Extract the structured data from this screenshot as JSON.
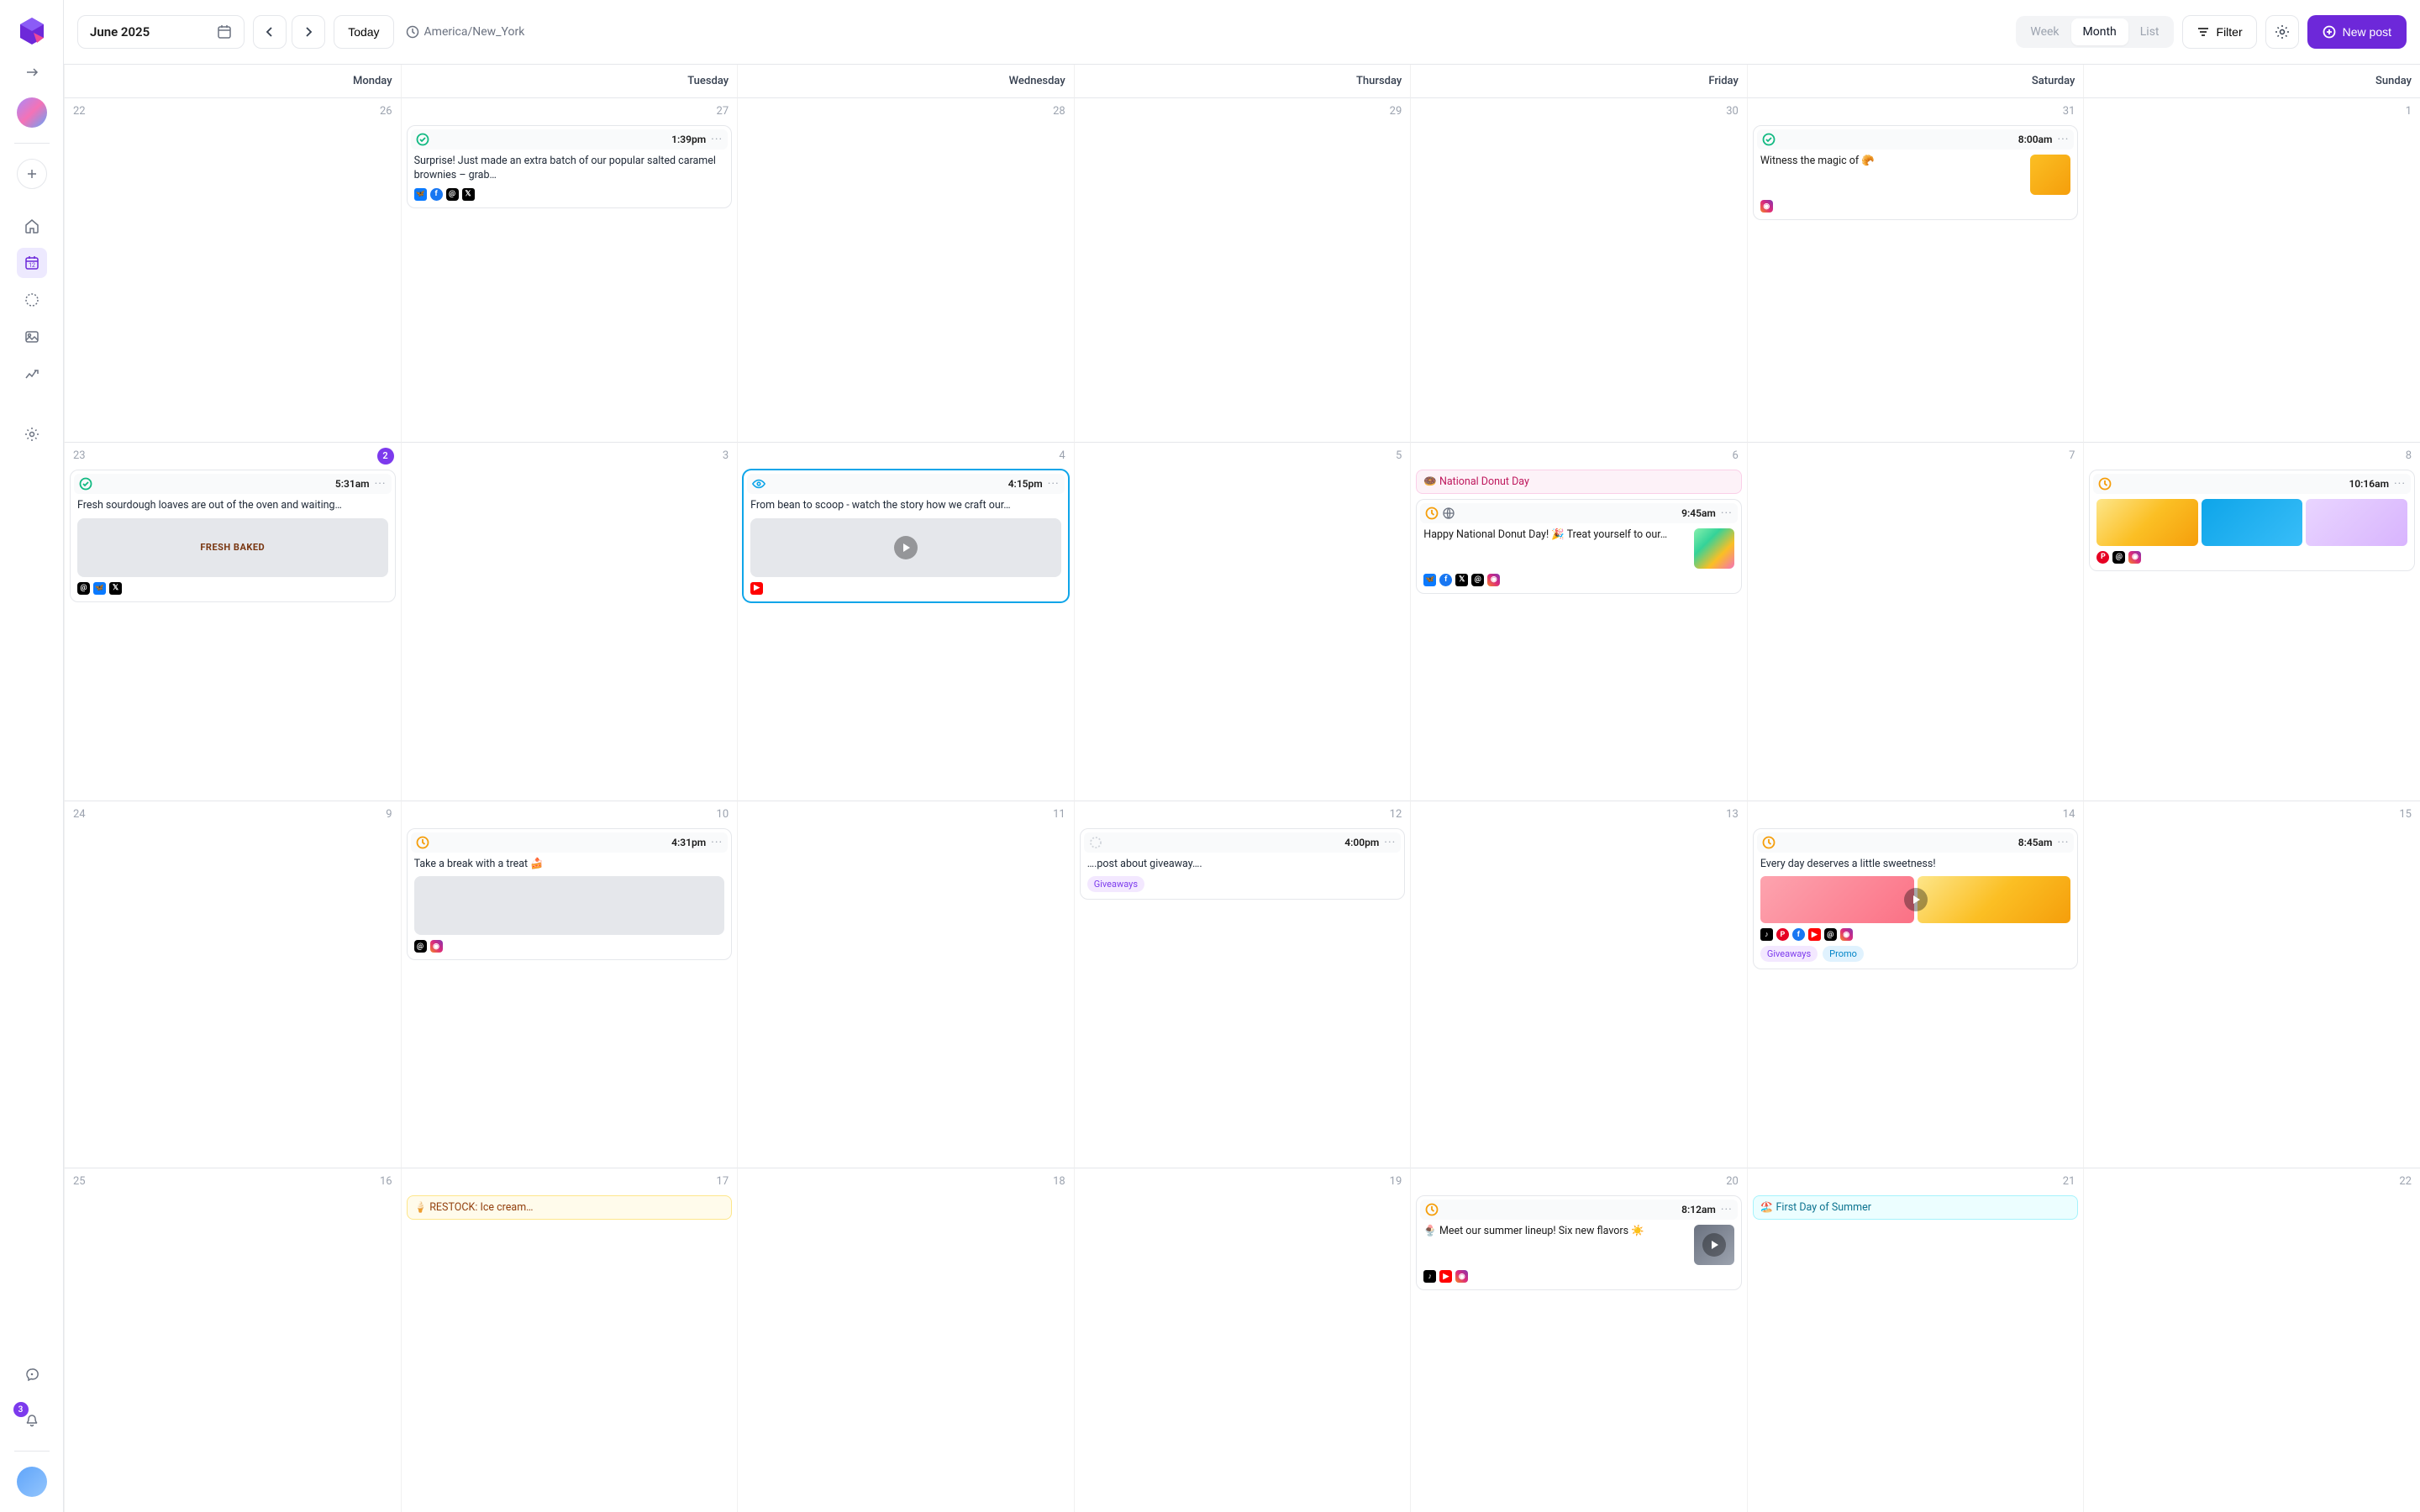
{
  "header": {
    "month_label": "June 2025",
    "today_label": "Today",
    "timezone": "America/New_York",
    "views": {
      "week": "Week",
      "month": "Month",
      "list": "List",
      "active": "Month"
    },
    "filter_label": "Filter",
    "new_post_label": "New post"
  },
  "sidebar": {
    "notifications_badge": "3"
  },
  "days_of_week": [
    "Monday",
    "Tuesday",
    "Wednesday",
    "Thursday",
    "Friday",
    "Saturday",
    "Sunday"
  ],
  "weeks": [
    {
      "cells": [
        {
          "left": "22",
          "right": "26"
        },
        {
          "right": "27",
          "posts": [
            {
              "id": "p27",
              "status": "sent",
              "time": "1:39pm",
              "text": "Surprise! Just made an extra batch of our popular salted caramel brownies – grab…",
              "social": [
                "bsky",
                "fb",
                "th",
                "x"
              ]
            }
          ]
        },
        {
          "right": "28"
        },
        {
          "right": "29"
        },
        {
          "right": "30"
        },
        {
          "right": "31",
          "posts": [
            {
              "id": "p31",
              "status": "sent",
              "time": "8:00am",
              "side_text": "Witness the magic of 🥐",
              "side_thumb": "g1",
              "social": [
                "ig"
              ]
            }
          ]
        },
        {
          "right": "1"
        }
      ]
    },
    {
      "cells": [
        {
          "left": "23",
          "right_badge": "2",
          "posts": [
            {
              "id": "p23a",
              "status": "sent",
              "time": "5:31am",
              "text": "Fresh sourdough loaves are out of the oven and waiting…",
              "thumb": "g12",
              "thumb_label": "FRESH BAKED",
              "social": [
                "th",
                "bsky",
                "x"
              ]
            }
          ]
        },
        {
          "right": "3"
        },
        {
          "right": "4",
          "posts": [
            {
              "id": "p4",
              "selected": true,
              "status": "eye",
              "time": "4:15pm",
              "text": "From bean to scoop - watch the story how we craft our…",
              "thumb": "g9",
              "video": true,
              "social": [
                "yt"
              ]
            }
          ]
        },
        {
          "right": "5"
        },
        {
          "right": "6",
          "event": {
            "style": "pink",
            "text": "🍩 National Donut Day"
          },
          "posts": [
            {
              "id": "p6",
              "status": "sched",
              "extra_icon": "globe",
              "time": "9:45am",
              "side_text": "Happy National Donut Day! 🎉 Treat yourself to our…",
              "side_thumb": "g4",
              "social": [
                "bsky",
                "fb",
                "x",
                "th",
                "ig"
              ]
            }
          ]
        },
        {
          "right": "7"
        },
        {
          "right": "8",
          "posts": [
            {
              "id": "p8",
              "status": "sched",
              "time": "10:16am",
              "thumb_row": [
                "g5",
                "g7",
                "g11"
              ],
              "social": [
                "pin",
                "th",
                "ig"
              ]
            }
          ]
        }
      ]
    },
    {
      "cells": [
        {
          "left": "24",
          "right": "9"
        },
        {
          "right": "10",
          "posts": [
            {
              "id": "p10",
              "status": "sched",
              "time": "4:31pm",
              "text": "Take a break with a treat 🍰",
              "thumb": "g10",
              "social": [
                "th",
                "ig"
              ]
            }
          ]
        },
        {
          "right": "11"
        },
        {
          "right": "12",
          "posts": [
            {
              "id": "p12",
              "status": "draft",
              "time": "4:00pm",
              "text": "….post about giveaway….",
              "tags": [
                {
                  "style": "purple",
                  "label": "Giveaways"
                }
              ]
            }
          ]
        },
        {
          "right": "13"
        },
        {
          "right": "14",
          "posts": [
            {
              "id": "p14",
              "status": "sched",
              "time": "8:45am",
              "text": "Every day deserves a little sweetness!",
              "thumb_row": [
                "g3",
                "g5"
              ],
              "video": true,
              "social": [
                "tt",
                "pin",
                "fb",
                "yt",
                "th",
                "ig"
              ],
              "tags": [
                {
                  "style": "purple",
                  "label": "Giveaways"
                },
                {
                  "style": "blue",
                  "label": "Promo"
                }
              ]
            }
          ]
        },
        {
          "right": "15"
        }
      ]
    },
    {
      "cells": [
        {
          "left": "25",
          "right": "16"
        },
        {
          "right": "17",
          "event": {
            "style": "yellow",
            "text": "🍦 RESTOCK: Ice cream…"
          }
        },
        {
          "right": "18"
        },
        {
          "right": "19"
        },
        {
          "right": "20",
          "posts": [
            {
              "id": "p20",
              "status": "sched",
              "time": "8:12am",
              "side_text": "🍨 Meet our summer lineup! Six new flavors ☀️",
              "side_thumb": "g6",
              "video": true,
              "social": [
                "tt",
                "yt",
                "ig"
              ]
            }
          ]
        },
        {
          "right": "21",
          "event": {
            "style": "teal",
            "text": "🏖️ First Day of Summer"
          }
        },
        {
          "right": "22"
        }
      ]
    }
  ]
}
